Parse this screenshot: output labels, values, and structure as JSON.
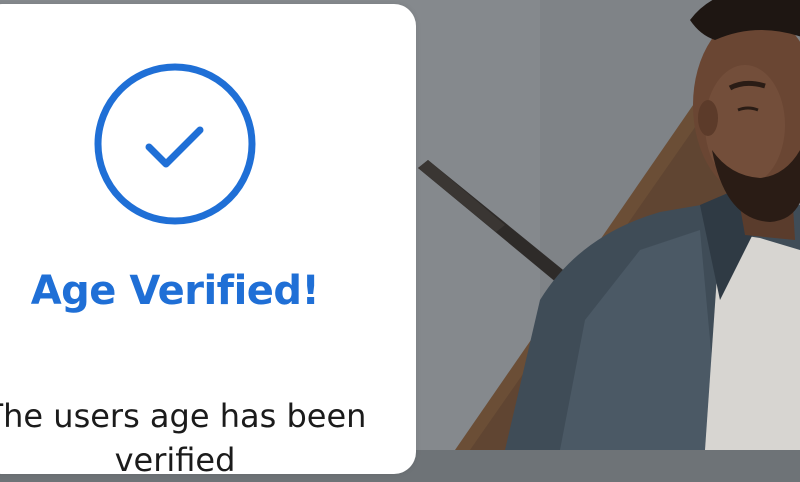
{
  "card": {
    "title": "Age Verified!",
    "message": "The users age has been verified"
  },
  "icons": {
    "status_icon": "check-circle-icon"
  },
  "colors": {
    "accent": "#1f6fd6",
    "card_background": "#ffffff",
    "text": "#1b1b1b"
  }
}
